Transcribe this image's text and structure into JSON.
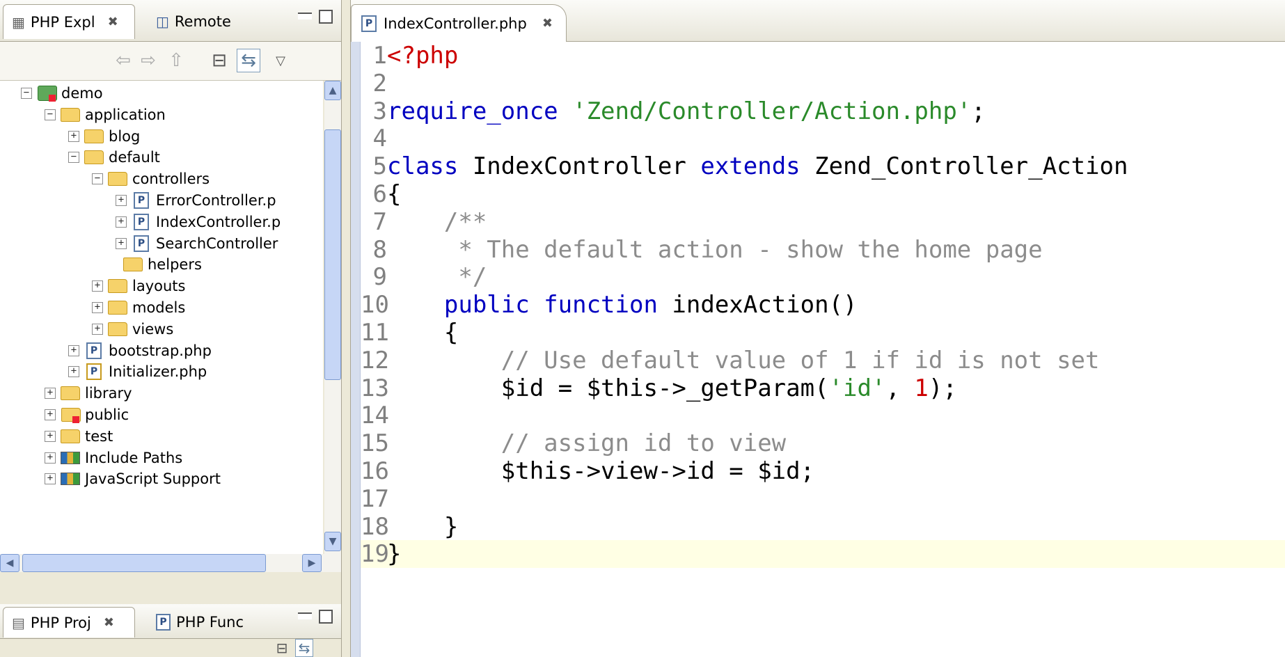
{
  "explorer": {
    "tabs": [
      {
        "label": "PHP Expl",
        "active": true,
        "icon": "php-explorer-icon"
      },
      {
        "label": "Remote",
        "active": false,
        "icon": "remote-systems-icon"
      }
    ],
    "toolbar_icons": [
      "back-icon",
      "forward-icon",
      "up-icon",
      "collapse-all-icon",
      "link-with-editor-icon",
      "view-menu-icon"
    ],
    "tree": [
      {
        "label": "demo",
        "depth": 0,
        "toggle": "-",
        "icon": "project-icon",
        "error": true
      },
      {
        "label": "application",
        "depth": 1,
        "toggle": "-",
        "icon": "folder-icon"
      },
      {
        "label": "blog",
        "depth": 2,
        "toggle": "+",
        "icon": "folder-icon"
      },
      {
        "label": "default",
        "depth": 2,
        "toggle": "-",
        "icon": "folder-icon"
      },
      {
        "label": "controllers",
        "depth": 3,
        "toggle": "-",
        "icon": "folder-icon"
      },
      {
        "label": "ErrorController.p",
        "depth": 4,
        "toggle": "+",
        "icon": "php-file-icon"
      },
      {
        "label": "IndexController.p",
        "depth": 4,
        "toggle": "+",
        "icon": "php-file-icon"
      },
      {
        "label": "SearchController",
        "depth": 4,
        "toggle": "+",
        "icon": "php-file-icon"
      },
      {
        "label": "helpers",
        "depth": 3,
        "toggle": "",
        "icon": "folder-icon"
      },
      {
        "label": "layouts",
        "depth": 3,
        "toggle": "+",
        "icon": "folder-icon"
      },
      {
        "label": "models",
        "depth": 3,
        "toggle": "+",
        "icon": "folder-icon"
      },
      {
        "label": "views",
        "depth": 3,
        "toggle": "+",
        "icon": "folder-icon"
      },
      {
        "label": "bootstrap.php",
        "depth": 2,
        "toggle": "+",
        "icon": "php-file-icon"
      },
      {
        "label": "Initializer.php",
        "depth": 2,
        "toggle": "+",
        "icon": "php-file-icon"
      },
      {
        "label": "library",
        "depth": 1,
        "toggle": "+",
        "icon": "folder-icon"
      },
      {
        "label": "public",
        "depth": 1,
        "toggle": "+",
        "icon": "folder-icon",
        "error": true
      },
      {
        "label": "test",
        "depth": 1,
        "toggle": "+",
        "icon": "folder-icon"
      },
      {
        "label": "Include Paths",
        "depth": 1,
        "toggle": "+",
        "icon": "library-icon"
      },
      {
        "label": "JavaScript Support",
        "depth": 1,
        "toggle": "+",
        "icon": "library-icon"
      }
    ]
  },
  "bottom_panel": {
    "tabs": [
      {
        "label": "PHP Proj",
        "active": true,
        "icon": "php-project-icon"
      },
      {
        "label": "PHP Func",
        "active": false,
        "icon": "php-functions-icon"
      }
    ]
  },
  "editor": {
    "tab_label": "IndexController.php",
    "current_line": 19,
    "lines": [
      {
        "n": "1",
        "tokens": [
          {
            "t": "<?php",
            "c": "php"
          }
        ]
      },
      {
        "n": "2",
        "tokens": []
      },
      {
        "n": "3",
        "tokens": [
          {
            "t": "require_once ",
            "c": "kw"
          },
          {
            "t": "'Zend/Controller/Action.php'",
            "c": "str"
          },
          {
            "t": ";",
            "c": "plain"
          }
        ]
      },
      {
        "n": "4",
        "tokens": []
      },
      {
        "n": "5",
        "tokens": [
          {
            "t": "class ",
            "c": "kw"
          },
          {
            "t": "IndexController ",
            "c": "plain"
          },
          {
            "t": "extends ",
            "c": "kw"
          },
          {
            "t": "Zend_Controller_Action",
            "c": "plain"
          }
        ]
      },
      {
        "n": "6",
        "tokens": [
          {
            "t": "{",
            "c": "plain"
          }
        ]
      },
      {
        "n": "7",
        "tokens": [
          {
            "t": "    /**",
            "c": "cm"
          }
        ]
      },
      {
        "n": "8",
        "tokens": [
          {
            "t": "     * The default action - show the home page",
            "c": "cm"
          }
        ]
      },
      {
        "n": "9",
        "tokens": [
          {
            "t": "     */",
            "c": "cm"
          }
        ]
      },
      {
        "n": "10",
        "tokens": [
          {
            "t": "    public function ",
            "c": "kw"
          },
          {
            "t": "indexAction()",
            "c": "plain"
          }
        ]
      },
      {
        "n": "11",
        "tokens": [
          {
            "t": "    {",
            "c": "plain"
          }
        ]
      },
      {
        "n": "12",
        "tokens": [
          {
            "t": "        // Use default value of 1 if id is not set",
            "c": "cm"
          }
        ]
      },
      {
        "n": "13",
        "tokens": [
          {
            "t": "        $id = $this->_getParam(",
            "c": "plain"
          },
          {
            "t": "'id'",
            "c": "str"
          },
          {
            "t": ", ",
            "c": "plain"
          },
          {
            "t": "1",
            "c": "num"
          },
          {
            "t": ");",
            "c": "plain"
          }
        ]
      },
      {
        "n": "14",
        "tokens": []
      },
      {
        "n": "15",
        "tokens": [
          {
            "t": "        // assign id to view",
            "c": "cm"
          }
        ]
      },
      {
        "n": "16",
        "tokens": [
          {
            "t": "        $this->view->id = $id;",
            "c": "plain"
          }
        ]
      },
      {
        "n": "17",
        "tokens": []
      },
      {
        "n": "18",
        "tokens": [
          {
            "t": "    }",
            "c": "plain"
          }
        ]
      },
      {
        "n": "19",
        "tokens": [
          {
            "t": "}",
            "c": "plain"
          }
        ]
      }
    ]
  }
}
